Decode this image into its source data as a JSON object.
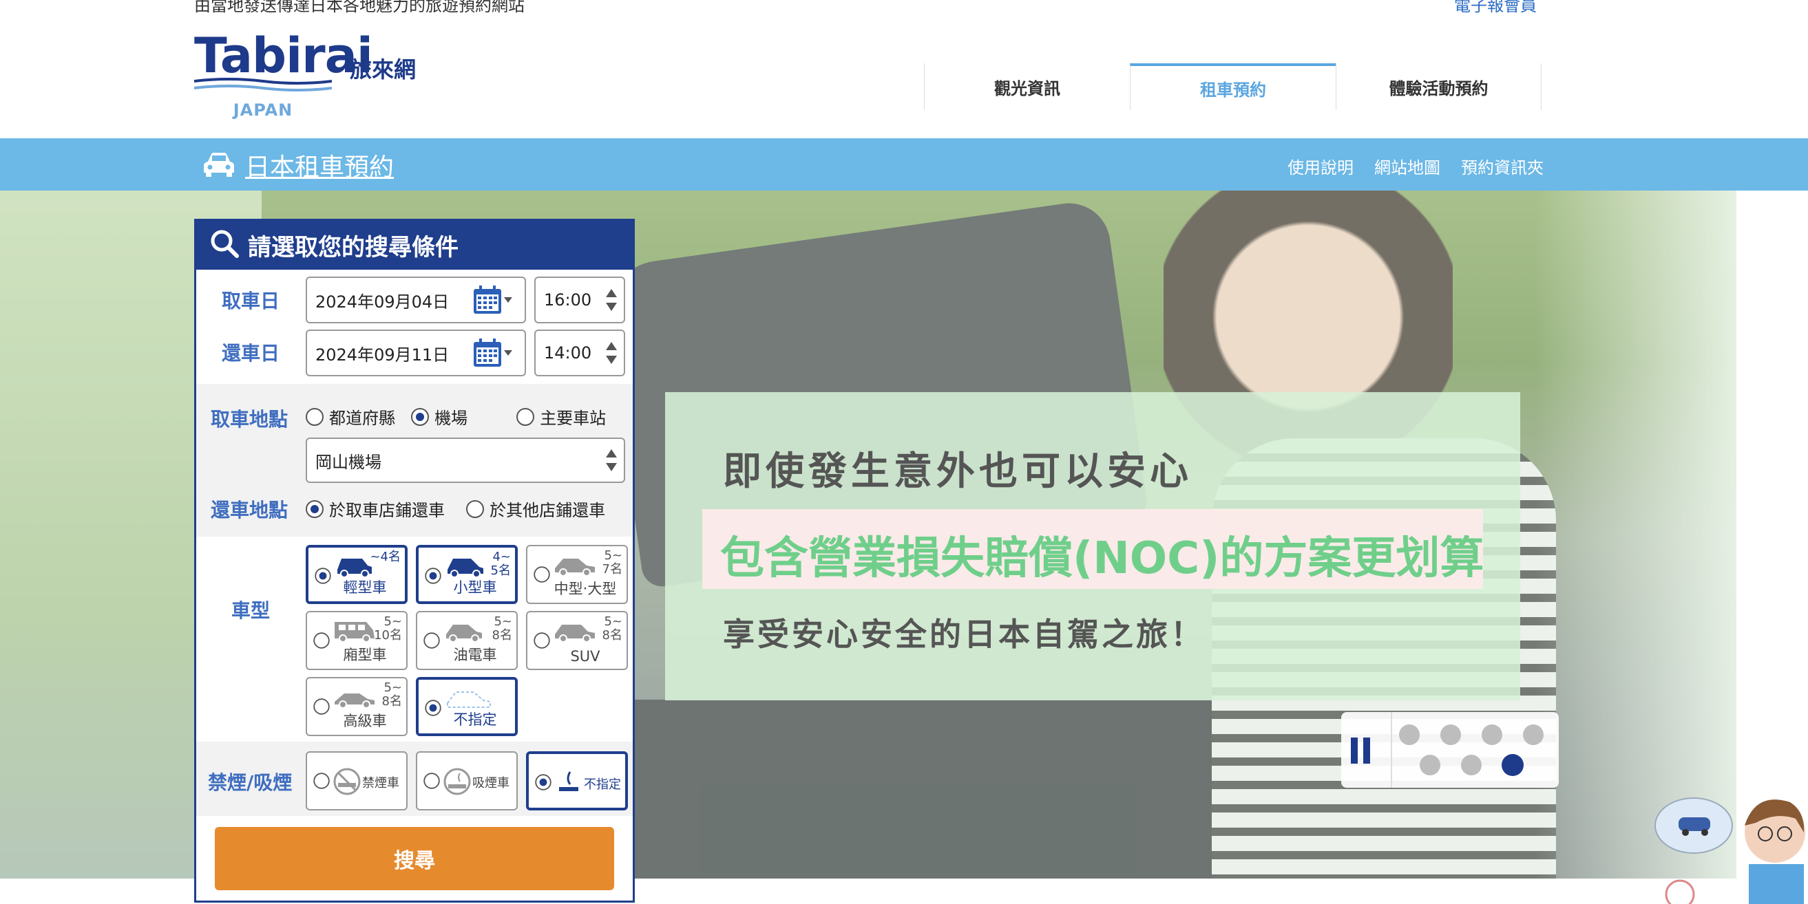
{
  "header": {
    "tagline": "由當地發送傳達日本各地魅力的旅遊預約網站",
    "member_link": "電子報會員",
    "logo_word": "Tabirai",
    "logo_sub": "JAPAN",
    "logo_cn": "旅來網",
    "nav": [
      {
        "label": "觀光資訊",
        "active": false
      },
      {
        "label": "租車預約",
        "active": true
      },
      {
        "label": "體驗活動預約",
        "active": false
      }
    ]
  },
  "bar": {
    "title": "日本租車預約",
    "links": [
      "使用說明",
      "網站地圖",
      "預約資訊夾"
    ]
  },
  "hero": {
    "line1": "即使發生意外也可以安心",
    "line2": "包含營業損失賠償(NOC)的方案更划算",
    "line3": "享受安心安全的日本自駕之旅！",
    "slides_total": 7,
    "active_slide": 7
  },
  "search": {
    "title": "請選取您的搜尋條件",
    "pickup_date_label": "取車日",
    "pickup_date": "2024年09月04日",
    "pickup_time": "16:00",
    "return_date_label": "還車日",
    "return_date": "2024年09月11日",
    "return_time": "14:00",
    "pickup_place_label": "取車地點",
    "place_options": [
      {
        "label": "都道府縣",
        "checked": false
      },
      {
        "label": "機場",
        "checked": true
      },
      {
        "label": "主要車站",
        "checked": false
      }
    ],
    "pickup_place_value": "岡山機場",
    "return_place_label": "還車地點",
    "return_options": [
      {
        "label": "於取車店鋪還車",
        "checked": true
      },
      {
        "label": "於其他店鋪還車",
        "checked": false
      }
    ],
    "car_type_label": "車型",
    "car_types": [
      {
        "name": "輕型車",
        "cap1": "",
        "cap2": "~4名",
        "selected": true
      },
      {
        "name": "小型車",
        "cap1": "4~",
        "cap2": "5名",
        "selected": true
      },
      {
        "name": "中型‧大型",
        "cap1": "5~",
        "cap2": "7名",
        "selected": false
      },
      {
        "name": "廂型車",
        "cap1": "5~",
        "cap2": "10名",
        "selected": false
      },
      {
        "name": "油電車",
        "cap1": "5~",
        "cap2": "8名",
        "selected": false
      },
      {
        "name": "SUV",
        "cap1": "5~",
        "cap2": "8名",
        "selected": false
      },
      {
        "name": "高級車",
        "cap1": "5~",
        "cap2": "8名",
        "selected": false
      },
      {
        "name": "不指定",
        "cap1": "",
        "cap2": "",
        "selected": true
      }
    ],
    "smoking_label": "禁煙/吸煙",
    "smoking_options": [
      {
        "name": "禁煙車",
        "selected": false
      },
      {
        "name": "吸煙車",
        "selected": false
      },
      {
        "name": "不指定",
        "selected": true
      }
    ],
    "submit_label": "搜尋"
  },
  "colors": {
    "navy": "#1f3e8c",
    "sky": "#6cb8e6",
    "orange": "#e68a2e",
    "green_text": "#6fcf8a"
  }
}
